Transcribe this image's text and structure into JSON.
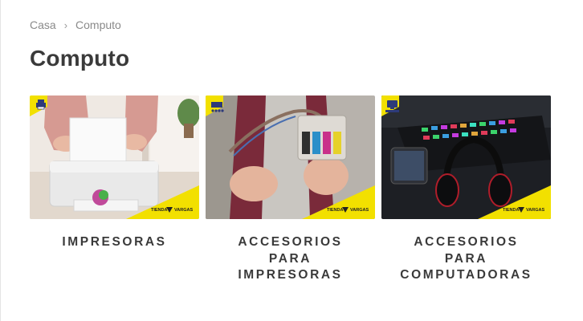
{
  "breadcrumb": {
    "home": "Casa",
    "separator": "›",
    "current": "Computo"
  },
  "page_title": "Computo",
  "brand_badge": {
    "left": "TIENDA",
    "right": "VARGAS"
  },
  "colors": {
    "accent_yellow": "#f2e000",
    "title": "#3a3a3a",
    "muted": "#8a8a8a"
  },
  "categories": [
    {
      "label": "IMPRESORAS",
      "icon": "printer-icon"
    },
    {
      "label": "ACCESORIOS PARA IMPRESORAS",
      "icon": "ink-cartridge-icon"
    },
    {
      "label": "ACCESORIOS PARA COMPUTADORAS",
      "icon": "computer-icon"
    }
  ]
}
